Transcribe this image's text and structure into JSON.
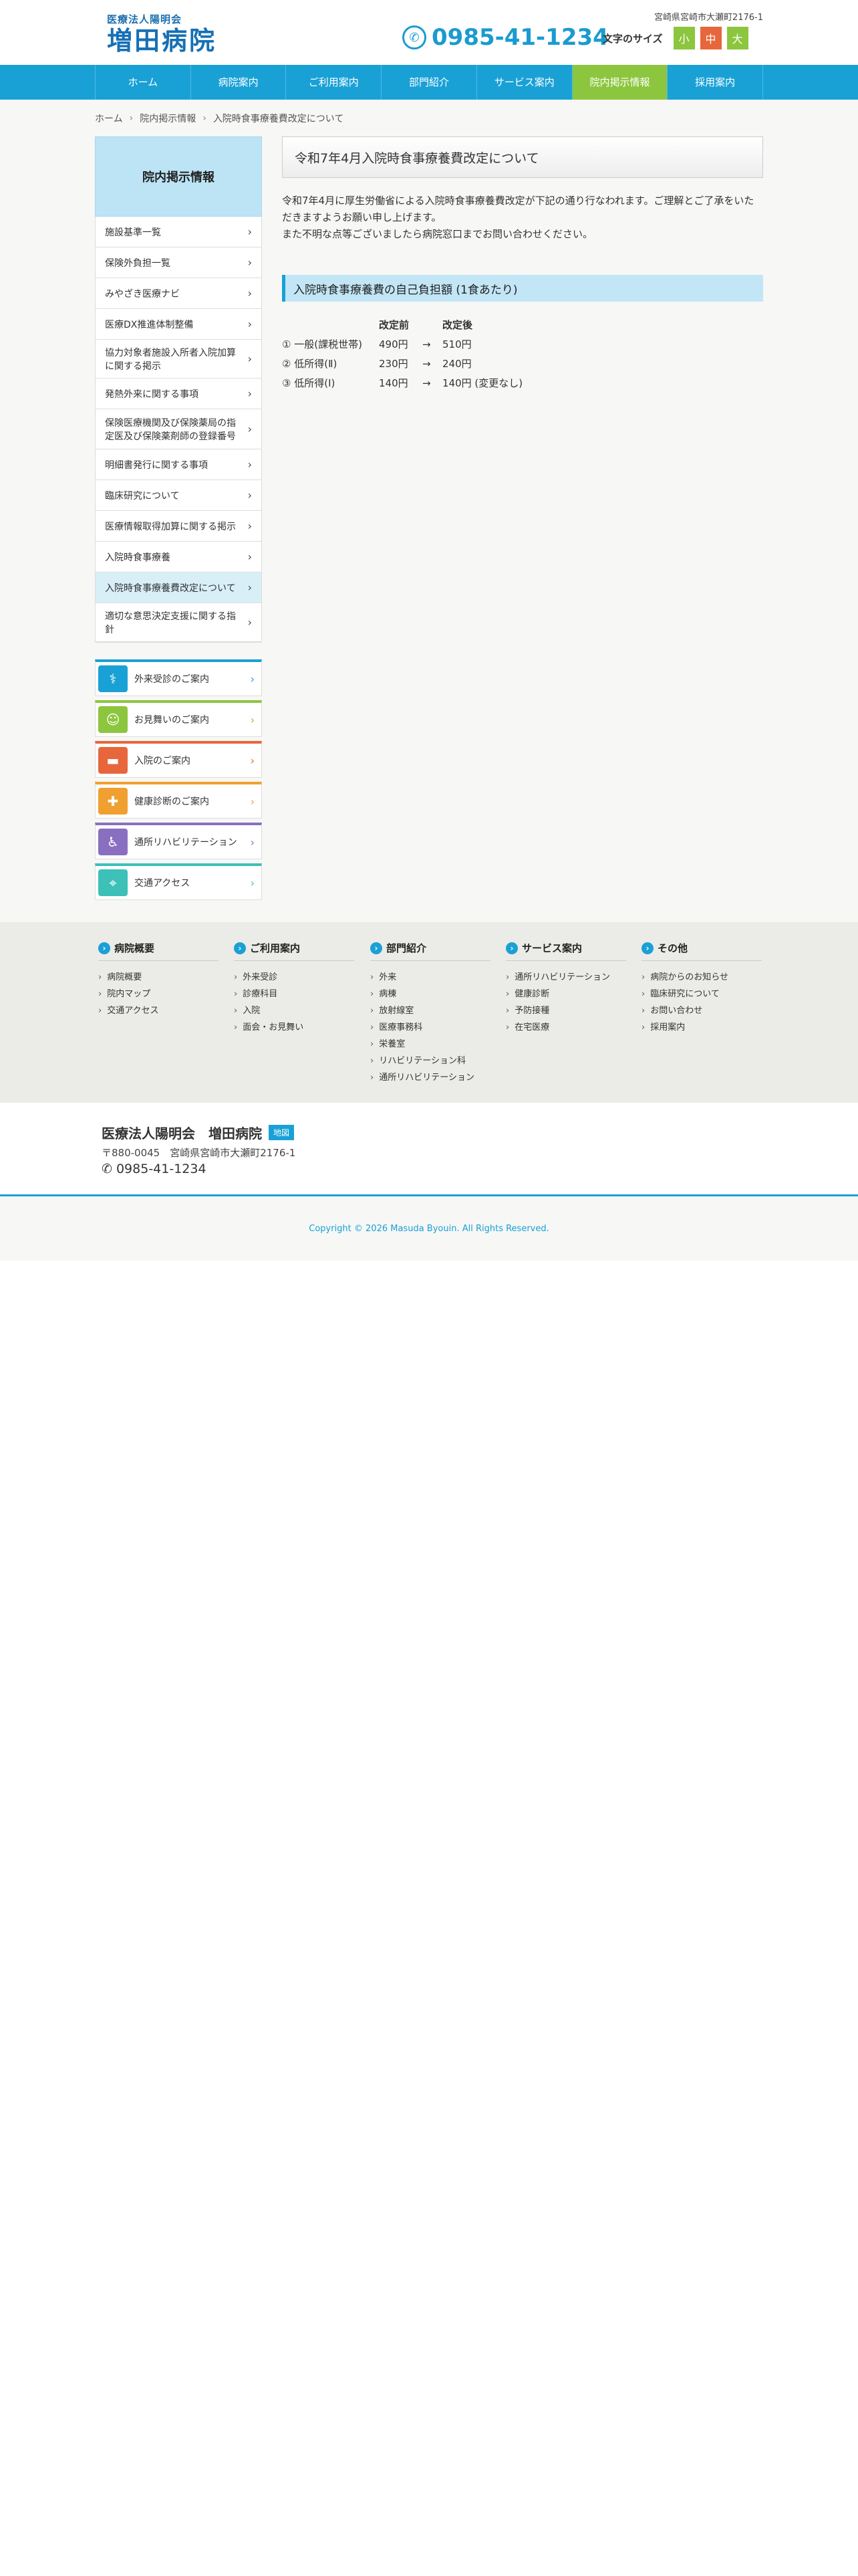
{
  "header": {
    "logo_sub": "医療法人陽明会",
    "logo_main": "増田病院",
    "address": "宮崎県宮崎市大瀬町2176-1",
    "tel": "0985-41-1234",
    "fontsize_label": "文字のサイズ",
    "fs_small": "小",
    "fs_medium": "中",
    "fs_large": "大"
  },
  "nav": [
    "ホーム",
    "病院案内",
    "ご利用案内",
    "部門紹介",
    "サービス案内",
    "院内掲示情報",
    "採用案内"
  ],
  "breadcrumb": [
    "ホーム",
    "院内掲示情報",
    "入院時食事療養費改定について"
  ],
  "sidebar": {
    "title": "院内掲示情報",
    "items": [
      "施設基準一覧",
      "保険外負担一覧",
      "みやざき医療ナビ",
      "医療DX推進体制整備",
      "協力対象者施設入所者入院加算に関する掲示",
      "発熱外来に関する事項",
      "保険医療機関及び保険薬局の指定医及び保険薬剤師の登録番号",
      "明細書発行に関する事項",
      "臨床研究について",
      "医療情報取得加算に関する掲示",
      "入院時食事療養",
      "入院時食事療養費改定について",
      "適切な意思決定支援に関する指針"
    ],
    "banners": [
      {
        "label": "外来受診のご案内",
        "icon": "doctor-icon",
        "color": "#19a1d6"
      },
      {
        "label": "お見舞いのご案内",
        "icon": "visitor-icon",
        "color": "#8cc63e"
      },
      {
        "label": "入院のご案内",
        "icon": "bed-icon",
        "color": "#e8663c"
      },
      {
        "label": "健康診断のご案内",
        "icon": "checkup-icon",
        "color": "#f0a030"
      },
      {
        "label": "通所リハビリテーション",
        "icon": "rehab-icon",
        "color": "#8a6fc1"
      },
      {
        "label": "交通アクセス",
        "icon": "map-icon",
        "color": "#3cc0b8"
      }
    ]
  },
  "main": {
    "title": "令和7年4月入院時食事療養費改定について",
    "intro_1": "令和7年4月に厚生労働省による入院時食事療養費改定が下記の通り行なわれます。ご理解とご了承をいただきますようお願い申し上げます。",
    "intro_2": "また不明な点等ございましたら病院窓口までお問い合わせください。",
    "section_title": "入院時食事療養費の自己負担額 (1食あたり)",
    "table_head": {
      "before": "改定前",
      "after": "改定後"
    },
    "arrow": "→",
    "rows": [
      {
        "label": "① 一般(課税世帯)",
        "before": "490円",
        "after": "510円"
      },
      {
        "label": "② 低所得(Ⅱ)",
        "before": "230円",
        "after": "240円"
      },
      {
        "label": "③ 低所得(Ⅰ)",
        "before": "140円",
        "after": "140円 (変更なし)"
      }
    ]
  },
  "footer_links": [
    {
      "title": "病院概要",
      "items": [
        "病院概要",
        "院内マップ",
        "交通アクセス"
      ]
    },
    {
      "title": "ご利用案内",
      "items": [
        "外来受診",
        "診療科目",
        "入院",
        "面会・お見舞い"
      ]
    },
    {
      "title": "部門紹介",
      "items": [
        "外来",
        "病棟",
        "放射線室",
        "医療事務科",
        "栄養室",
        "リハビリテーション科",
        "通所リハビリテーション"
      ]
    },
    {
      "title": "サービス案内",
      "items": [
        "通所リハビリテーション",
        "健康診断",
        "予防接種",
        "在宅医療"
      ]
    },
    {
      "title": "その他",
      "items": [
        "病院からのお知らせ",
        "臨床研究について",
        "お問い合わせ",
        "採用案内"
      ]
    }
  ],
  "footer_info": {
    "name": "医療法人陽明会　増田病院",
    "badge": "地図",
    "address": "〒880-0045　宮崎県宮崎市大瀬町2176-1",
    "tel": "0985-41-1234"
  },
  "copyright": "Copyright © 2026 Masuda Byouin. All Rights Reserved."
}
